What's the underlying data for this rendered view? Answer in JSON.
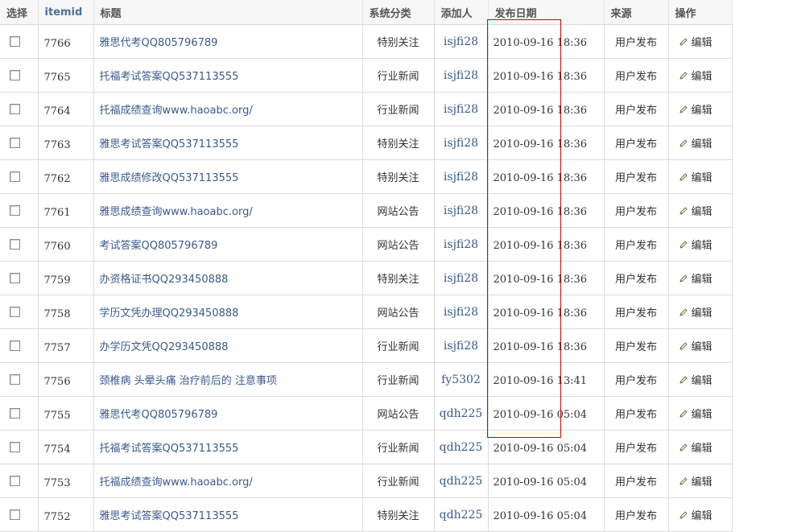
{
  "headers": {
    "select": "选择",
    "itemid": "itemid",
    "title": "标题",
    "category": "系统分类",
    "author": "添加人",
    "date": "发布日期",
    "source": "来源",
    "action": "操作"
  },
  "rows": [
    {
      "id": "7766",
      "title": "雅思代考QQ805796789",
      "category": "特别关注",
      "author": "isjfi28",
      "date": "2010-09-16 18:36",
      "source": "用户发布",
      "action": "编辑"
    },
    {
      "id": "7765",
      "title": "托福考试答案QQ537113555",
      "category": "行业新闻",
      "author": "isjfi28",
      "date": "2010-09-16 18:36",
      "source": "用户发布",
      "action": "编辑"
    },
    {
      "id": "7764",
      "title": "托福成绩查询www.haoabc.org/",
      "category": "行业新闻",
      "author": "isjfi28",
      "date": "2010-09-16 18:36",
      "source": "用户发布",
      "action": "编辑"
    },
    {
      "id": "7763",
      "title": "雅思考试答案QQ537113555",
      "category": "特别关注",
      "author": "isjfi28",
      "date": "2010-09-16 18:36",
      "source": "用户发布",
      "action": "编辑"
    },
    {
      "id": "7762",
      "title": "雅思成绩修改QQ537113555",
      "category": "特别关注",
      "author": "isjfi28",
      "date": "2010-09-16 18:36",
      "source": "用户发布",
      "action": "编辑"
    },
    {
      "id": "7761",
      "title": "雅思成绩查询www.haoabc.org/",
      "category": "网站公告",
      "author": "isjfi28",
      "date": "2010-09-16 18:36",
      "source": "用户发布",
      "action": "编辑"
    },
    {
      "id": "7760",
      "title": "考试答案QQ805796789",
      "category": "网站公告",
      "author": "isjfi28",
      "date": "2010-09-16 18:36",
      "source": "用户发布",
      "action": "编辑"
    },
    {
      "id": "7759",
      "title": "办资格证书QQ293450888",
      "category": "特别关注",
      "author": "isjfi28",
      "date": "2010-09-16 18:36",
      "source": "用户发布",
      "action": "编辑"
    },
    {
      "id": "7758",
      "title": "学历文凭办理QQ293450888",
      "category": "网站公告",
      "author": "isjfi28",
      "date": "2010-09-16 18:36",
      "source": "用户发布",
      "action": "编辑"
    },
    {
      "id": "7757",
      "title": "办学历文凭QQ293450888",
      "category": "行业新闻",
      "author": "isjfi28",
      "date": "2010-09-16 18:36",
      "source": "用户发布",
      "action": "编辑"
    },
    {
      "id": "7756",
      "title": "颈椎病 头晕头痛 治疗前后的 注意事项",
      "category": "行业新闻",
      "author": "fy5302",
      "date": "2010-09-16 13:41",
      "source": "用户发布",
      "action": "编辑"
    },
    {
      "id": "7755",
      "title": "雅思代考QQ805796789",
      "category": "网站公告",
      "author": "qdh225",
      "date": "2010-09-16 05:04",
      "source": "用户发布",
      "action": "编辑"
    },
    {
      "id": "7754",
      "title": "托福考试答案QQ537113555",
      "category": "行业新闻",
      "author": "qdh225",
      "date": "2010-09-16 05:04",
      "source": "用户发布",
      "action": "编辑"
    },
    {
      "id": "7753",
      "title": "托福成绩查询www.haoabc.org/",
      "category": "行业新闻",
      "author": "qdh225",
      "date": "2010-09-16 05:04",
      "source": "用户发布",
      "action": "编辑"
    },
    {
      "id": "7752",
      "title": "雅思考试答案QQ537113555",
      "category": "特别关注",
      "author": "qdh225",
      "date": "2010-09-16 05:04",
      "source": "用户发布",
      "action": "编辑"
    }
  ],
  "colors": {
    "link": "#3a5a8c",
    "highlight_border": "#d40000"
  },
  "icons": {
    "edit": "pencil-icon"
  }
}
